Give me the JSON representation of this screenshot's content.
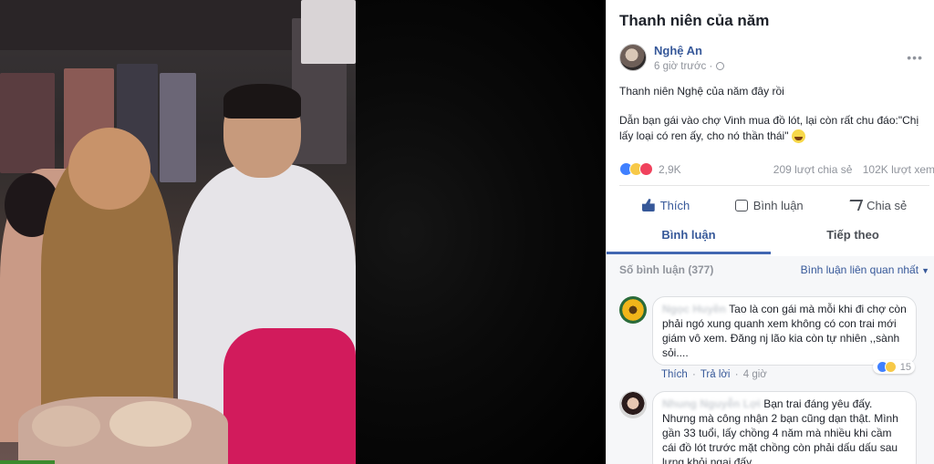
{
  "post": {
    "title": "Thanh niên của năm",
    "author_name": "Nghệ An",
    "time": "6 giờ trước ·",
    "more": "•••",
    "text_line1": "Thanh niên Nghệ của năm đây rồi",
    "text_line2": "Dẫn bạn gái vào chợ Vinh mua đồ lót, lại còn rất chu đáo:\"Chị lấy loại có ren ấy, cho nó thần thái\""
  },
  "stats": {
    "reaction_count": "2,9K",
    "shares": "209 lượt chia sẻ",
    "views": "102K lượt xem"
  },
  "actions": {
    "like": "Thích",
    "comment": "Bình luận",
    "share": "Chia sẻ"
  },
  "tabs": {
    "comments": "Bình luận",
    "next": "Tiếp theo"
  },
  "comments_header": {
    "count": "Số bình luận (377)",
    "sort": "Bình luận liên quan nhất"
  },
  "comments": [
    {
      "name": "Ngọc Huyền",
      "text": "Tao là con gái mà mỗi khi đi chợ còn phải ngó xung quanh xem không có con trai mới giám vô xem. Đăng nj lão kia còn tự nhiên ,,sành sỏi....",
      "like": "Thích",
      "reply": "Trả lời",
      "time": "4 giờ",
      "reactions": "15"
    },
    {
      "name": "Nhung Nguyễn Lợi",
      "text": "Bạn trai đáng yêu đấy. Nhưng mà công nhận 2 bạn cũng dạn thật. Mình gần 33 tuổi, lấy chồng 4 năm mà nhiều khi cầm cái đồ lót trước mặt chồng còn phải dấu dấu sau lưng khỏi ngại đấy."
    }
  ]
}
